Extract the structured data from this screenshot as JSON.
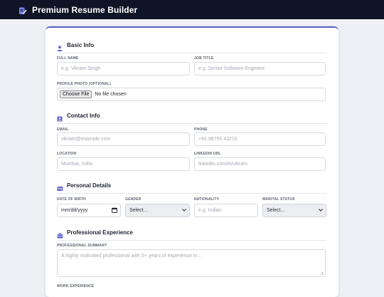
{
  "app": {
    "title": "Premium Resume Builder"
  },
  "sections": {
    "basic": {
      "title": "Basic Info",
      "full_name_label": "FULL NAME",
      "full_name_placeholder": "e.g. Vikram Singh",
      "job_title_label": "JOB TITLE",
      "job_title_placeholder": "e.g. Senior Software Engineer",
      "photo_label": "PROFILE PHOTO (OPTIONAL)",
      "photo_button": "Choose File",
      "photo_status": "No file chosen"
    },
    "contact": {
      "title": "Contact Info",
      "email_label": "EMAIL",
      "email_placeholder": "vikram@example.com",
      "phone_label": "PHONE",
      "phone_placeholder": "+91 98765 43210",
      "location_label": "LOCATION",
      "location_placeholder": "Mumbai, India",
      "linkedin_label": "LINKEDIN URL",
      "linkedin_placeholder": "linkedin.com/in/vikram"
    },
    "personal": {
      "title": "Personal Details",
      "dob_label": "DATE OF BIRTH",
      "dob_value": "mm/dd/yyyy",
      "gender_label": "GENDER",
      "gender_value": "Select...",
      "nationality_label": "NATIONALITY",
      "nationality_placeholder": "e.g. Indian",
      "marital_label": "MARITAL STATUS",
      "marital_value": "Select..."
    },
    "professional": {
      "title": "Professional Experience",
      "summary_label": "PROFESSIONAL SUMMARY",
      "summary_placeholder": "A highly motivated professional with 5+ years of experience in...",
      "work_label": "WORK EXPERIENCE"
    }
  },
  "colors": {
    "accent": "#5b5fc7",
    "topbar": "#0f1526"
  }
}
